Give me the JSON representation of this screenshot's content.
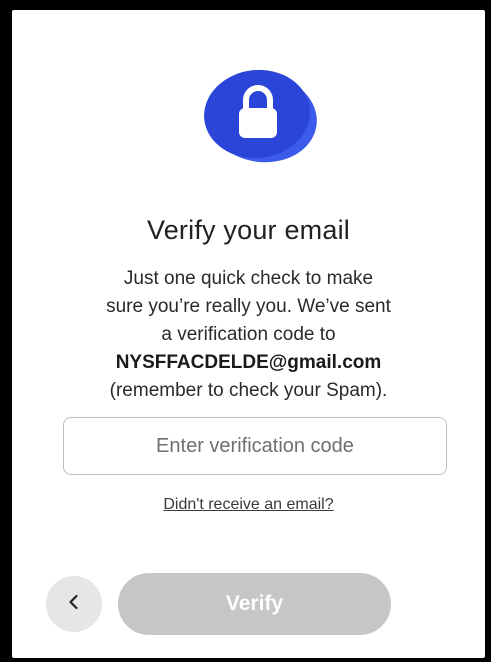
{
  "header": {
    "icon": "lock-icon",
    "title": "Verify your email"
  },
  "message": {
    "line1": "Just one quick check to make",
    "line2": "sure you’re really you. We’ve sent",
    "line3": "a verification code to",
    "email": "NYSFFACDELDE@gmail.com",
    "line4": "(remember to check your Spam)."
  },
  "form": {
    "code_placeholder": "Enter verification code",
    "code_value": "",
    "resend_label": "Didn't receive an email?"
  },
  "actions": {
    "back_icon": "chevron-left-icon",
    "verify_label": "Verify"
  },
  "colors": {
    "accent": "#2f4fe0",
    "button_disabled": "#c6c6c6"
  }
}
